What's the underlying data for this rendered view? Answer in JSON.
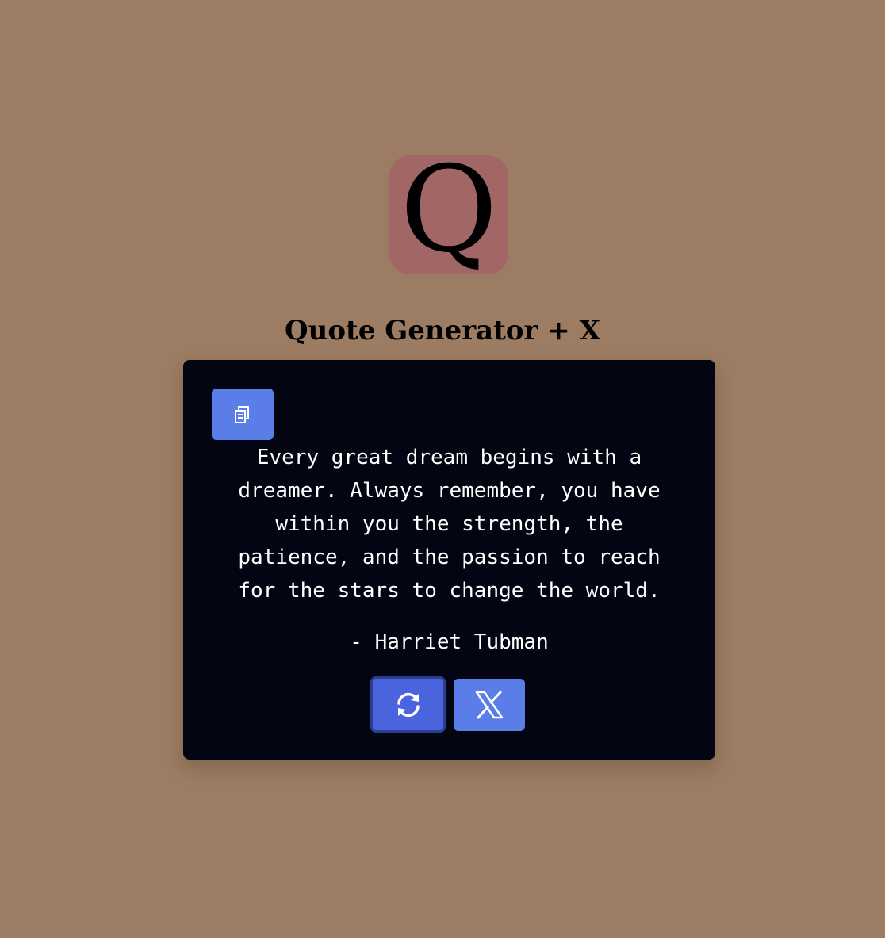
{
  "logo": {
    "letter": "Q",
    "background": "#a36666"
  },
  "header": {
    "title": "Quote Generator + X"
  },
  "quote": {
    "text": "Every great dream begins with a dreamer. Always remember, you have within you the strength, the patience, and the passion to reach for the stars to change the world.",
    "author": "- Harriet Tubman"
  },
  "buttons": {
    "copy_icon": "copy-icon",
    "new_quote_icon": "refresh-icon",
    "tweet_icon": "x-logo-icon"
  },
  "colors": {
    "page_background": "#9c7c62",
    "card_background": "#030612",
    "button_accent": "#5b7de8",
    "button_active": "#4a64de"
  }
}
